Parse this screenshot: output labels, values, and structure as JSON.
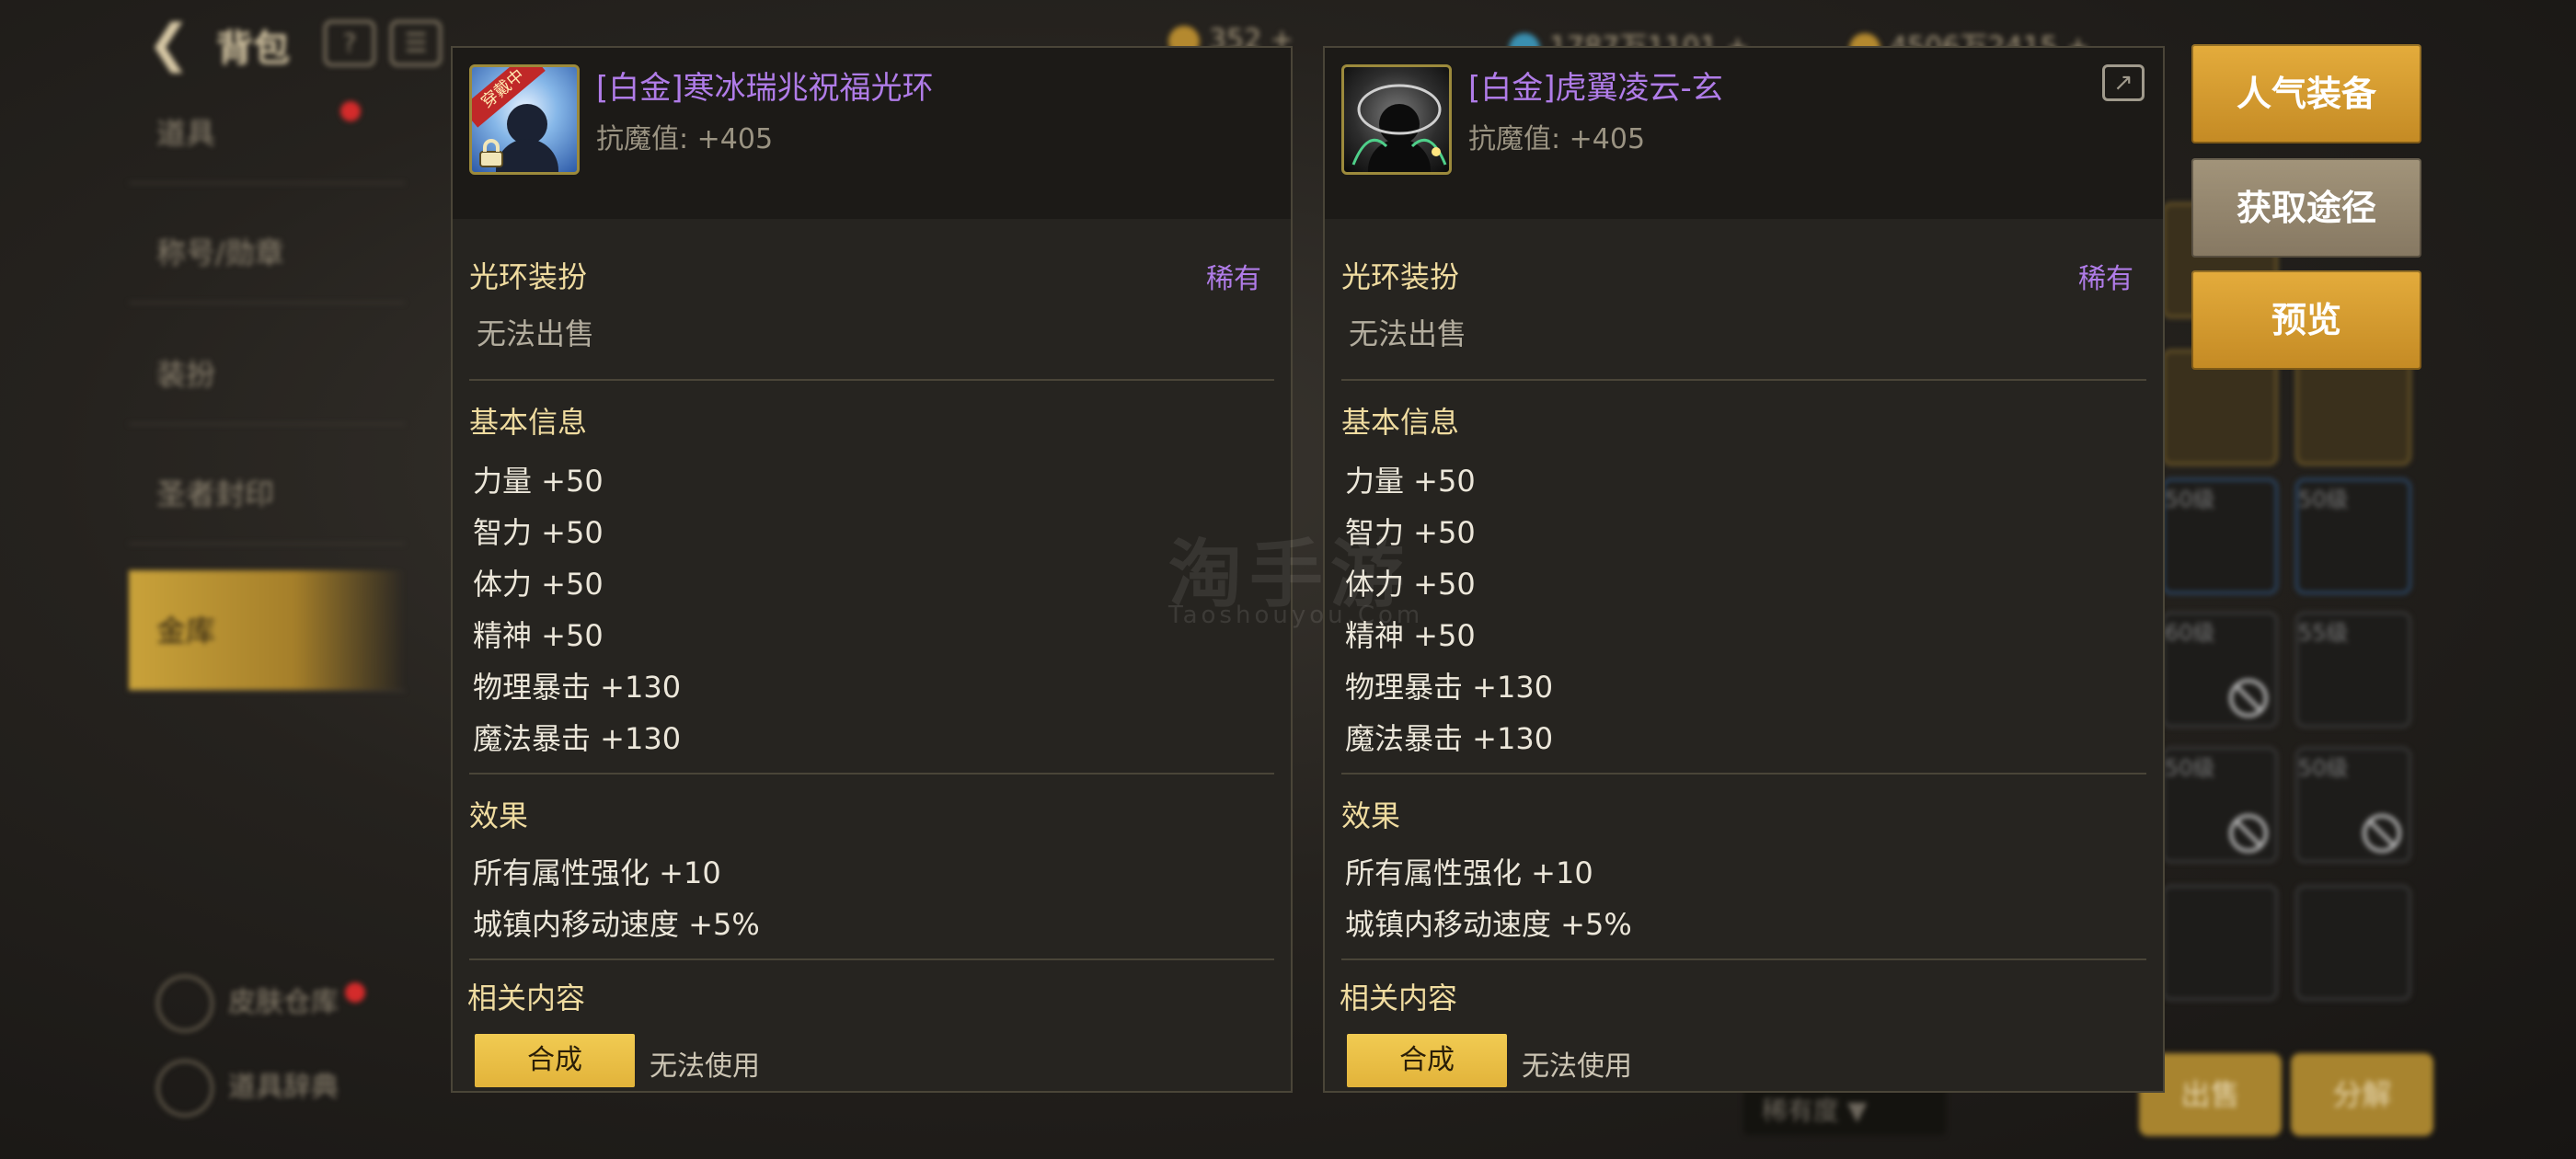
{
  "topbar": {
    "title": "背包",
    "currency_1": "352",
    "currency_2": "1787万1101",
    "currency_3": "4506万2415"
  },
  "nav": {
    "items": [
      {
        "label": "道具"
      },
      {
        "label": "称号/勋章"
      },
      {
        "label": "装扮"
      },
      {
        "label": "圣者封印"
      },
      {
        "label": "金库"
      }
    ],
    "skin_storage": "皮肤仓库",
    "item_dict": "道具辞典"
  },
  "grid": {
    "levels": [
      "50级",
      "50级",
      "60级",
      "55级",
      "50级",
      "50级"
    ],
    "sell_label": "出售",
    "dismantle_label": "分解",
    "rarity_dropdown": "稀有度"
  },
  "watermark": {
    "main": "淘手游",
    "sub": "Taoshouyou.Com"
  },
  "left_panel": {
    "wearing_tag": "穿戴中",
    "name": "[白金]寒冰瑞兆祝福光环",
    "stat": "抗魔值: +405",
    "category": "光环装扮",
    "rarity": "稀有",
    "sell_status": "无法出售",
    "basic_title": "基本信息",
    "stats": [
      "力量 +50",
      "智力 +50",
      "体力 +50",
      "精神 +50",
      "物理暴击 +130",
      "魔法暴击 +130"
    ],
    "effect_title": "效果",
    "effects": [
      "所有属性强化 +10",
      "城镇内移动速度 +5%"
    ],
    "related_title": "相关内容",
    "compose_label": "合成",
    "cannot_use": "无法使用"
  },
  "right_panel": {
    "name": "[白金]虎翼凌云-玄",
    "stat": "抗魔值: +405",
    "category": "光环装扮",
    "rarity": "稀有",
    "sell_status": "无法出售",
    "basic_title": "基本信息",
    "stats": [
      "力量 +50",
      "智力 +50",
      "体力 +50",
      "精神 +50",
      "物理暴击 +130",
      "魔法暴击 +130"
    ],
    "effect_title": "效果",
    "effects": [
      "所有属性强化 +10",
      "城镇内移动速度 +5%"
    ],
    "related_title": "相关内容",
    "compose_label": "合成",
    "cannot_use": "无法使用"
  },
  "actions": {
    "popular_equip": "人气装备",
    "get_source": "获取途径",
    "preview": "预览"
  },
  "colors": {
    "item_name": "#b07ce8",
    "section_title": "#f0dca0",
    "gold_button": "#e2b33a"
  }
}
